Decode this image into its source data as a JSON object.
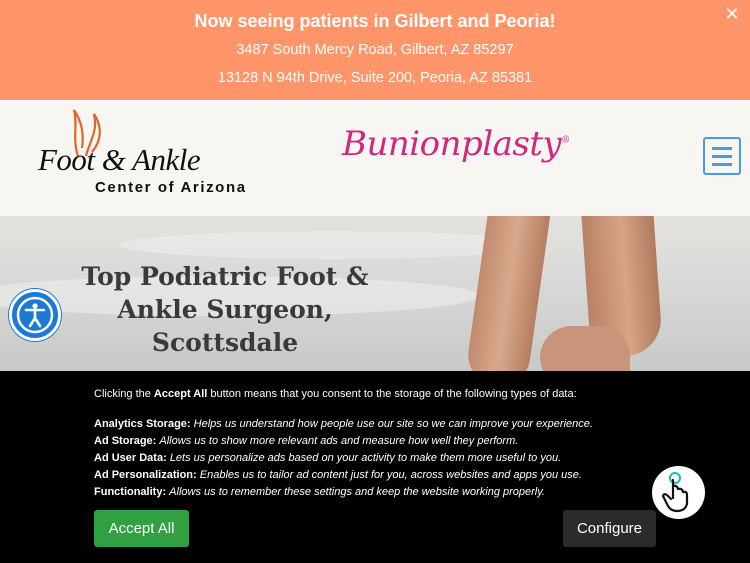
{
  "banner": {
    "title": "Now seeing patients in Gilbert and Peoria!",
    "address_1": "3487 South Mercy Road, Gilbert, AZ 85297",
    "address_2": "13128 N 94th Drive, Suite 200, Peoria, AZ 85381",
    "close_icon": "✕"
  },
  "header": {
    "logo_line1": "Foot & Ankle",
    "logo_line2": "Center of Arizona",
    "bunion_logo": "Bunionplasty",
    "registered": "®",
    "menu_icon": "hamburger-menu-icon"
  },
  "hero": {
    "heading": "Top Podiatric Foot & Ankle Surgeon, Scottsdale"
  },
  "consent": {
    "intro_prefix": "Clicking the ",
    "intro_bold": "Accept All",
    "intro_suffix": " button means that you consent to the storage of the following types of data:",
    "items": [
      {
        "label": "Analytics Storage:",
        "text": "Helps us understand how people use our site so we can improve your experience."
      },
      {
        "label": "Ad Storage:",
        "text": "Allows us to show more relevant ads and measure how well they perform."
      },
      {
        "label": "Ad User Data:",
        "text": "Lets us personalize ads based on your activity to make them more useful to you."
      },
      {
        "label": "Ad Personalization:",
        "text": "Enables us to tailor ad content just for you, across websites and apps you use."
      },
      {
        "label": "Functionality:",
        "text": "Allows us to remember these settings and keep the website working properly."
      }
    ],
    "accept_label": "Accept All",
    "configure_label": "Configure"
  },
  "colors": {
    "banner_bg": "#ff9569",
    "brand_pink": "#d2277d",
    "menu_blue": "#4a9be0",
    "accept_green": "#31a042",
    "a11y_blue": "#1c7ad6"
  }
}
